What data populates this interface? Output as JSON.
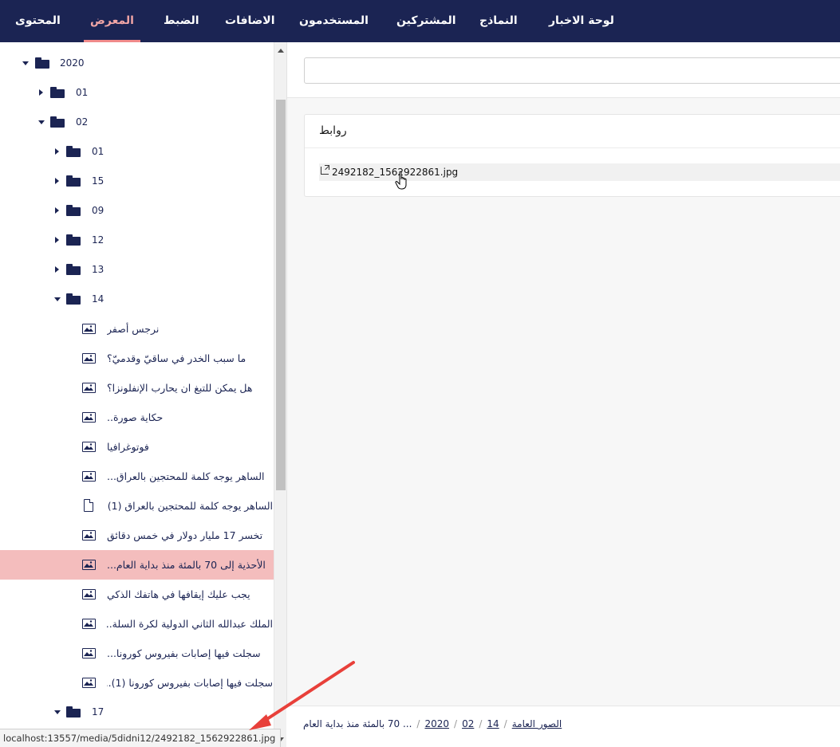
{
  "nav": {
    "items": [
      "المحتوى",
      "المعرض",
      "الضبط",
      "الاضافات",
      "المستخدمون",
      "المشتركين",
      "النماذج",
      "لوحة الاخبار"
    ],
    "active_index": 1
  },
  "tree": {
    "folders": {
      "year": "2020",
      "m01": "01",
      "m02": "02",
      "d01": "01",
      "d15": "15",
      "d09": "09",
      "d12": "12",
      "d13": "13",
      "d14": "14",
      "d17": "17"
    },
    "items": [
      "نرجس أصفر",
      "ما سبب الخدر في ساقيّ وقدميّ؟",
      "هل يمكن للتبغ ان يحارب الإنفلونزا؟",
      "حكاية صورة..",
      "فوتوغرافيا",
      "الساهر يوجه كلمة للمحتجين بالعراق...",
      "الساهر يوجه كلمة للمحتجين بالعراق (1)...",
      "تخسر 17 مليار دولار في خمس دقائق",
      "الأحذية إلى 70 بالمئة منذ بداية العام...",
      "يجب عليك إيقافها في هاتفك الذكي",
      "الملك عبدالله الثاني الدولية لكرة السلة...",
      "سجلت فيها إصابات بفيروس كورونا...",
      "سجلت فيها إصابات بفيروس كورونا (1)..."
    ],
    "selected_index": 8
  },
  "main": {
    "search_value": "",
    "links_title": "روابط",
    "link_filename": "2492182_1562922861.jpg"
  },
  "breadcrumb": {
    "root": "الصور العامة",
    "year": "2020",
    "month": "02",
    "day": "14",
    "current": "... 70 بالمئة منذ بداية العام"
  },
  "status": {
    "url": "localhost:13557/media/5didni12/2492182_1562922861.jpg"
  },
  "colors": {
    "nav_bg": "#1b2453",
    "accent": "#f08a8a",
    "selected_row": "#f4bdbd",
    "annotation_arrow": "#e8403a"
  }
}
